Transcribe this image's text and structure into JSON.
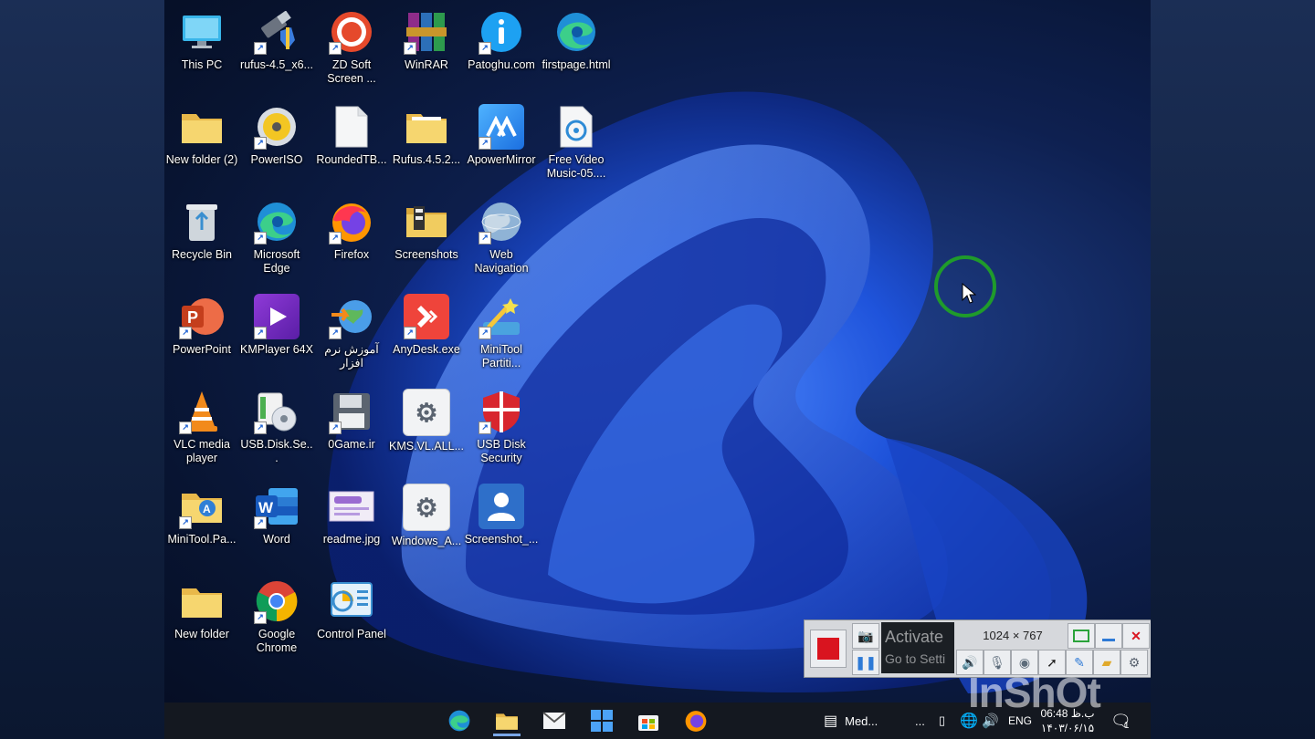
{
  "desktop": {
    "icons": [
      {
        "label": "This PC"
      },
      {
        "label": "rufus-4.5_x6..."
      },
      {
        "label": "ZD Soft Screen ..."
      },
      {
        "label": "WinRAR"
      },
      {
        "label": "Patoghu.com"
      },
      {
        "label": "firstpage.html"
      },
      {
        "label": "New folder (2)"
      },
      {
        "label": "PowerISO"
      },
      {
        "label": "RoundedTB..."
      },
      {
        "label": "Rufus.4.5.2..."
      },
      {
        "label": "ApowerMirror"
      },
      {
        "label": "Free Video Music-05...."
      },
      {
        "label": "Recycle Bin"
      },
      {
        "label": "Microsoft Edge"
      },
      {
        "label": "Firefox"
      },
      {
        "label": "Screenshots"
      },
      {
        "label": "Web Navigation"
      },
      {
        "label": "PowerPoint"
      },
      {
        "label": "KMPlayer 64X"
      },
      {
        "label": "آموزش نرم افزار"
      },
      {
        "label": "AnyDesk.exe"
      },
      {
        "label": "MiniTool Partiti..."
      },
      {
        "label": "VLC media player"
      },
      {
        "label": "USB.Disk.Se..."
      },
      {
        "label": "0Game.ir"
      },
      {
        "label": "KMS.VL.ALL..."
      },
      {
        "label": "USB Disk Security"
      },
      {
        "label": "MiniTool.Pa..."
      },
      {
        "label": "Word"
      },
      {
        "label": "readme.jpg"
      },
      {
        "label": "Windows_A..."
      },
      {
        "label": "Screenshot_..."
      },
      {
        "label": "New folder"
      },
      {
        "label": "Google Chrome"
      },
      {
        "label": "Control Panel"
      }
    ]
  },
  "recorder": {
    "resolution": "1024 × 767",
    "activate_line1": "Activate",
    "activate_line2": "Go to Setti"
  },
  "taskbar": {
    "widget_label": "Med...",
    "more": "...",
    "language": "ENG",
    "time": "06:48 ب.ظ",
    "date": "۱۴۰۳/۰۶/۱۵",
    "notification_count": "1"
  },
  "watermark": "InShOt",
  "colors": {
    "accent": "#1f9b2b",
    "record": "#d9141f"
  }
}
